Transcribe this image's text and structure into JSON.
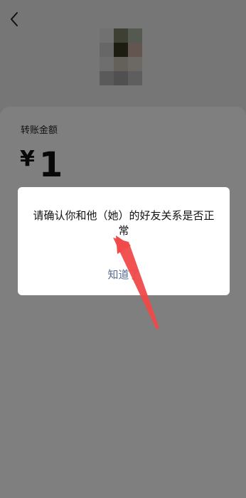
{
  "header": {
    "back_icon": "chevron-left-icon"
  },
  "transfer": {
    "label": "转账金额",
    "currency_symbol": "¥",
    "amount": "1"
  },
  "dialog": {
    "message": "请确认你和他（她）的好友关系是否正常",
    "button_label": "知道了"
  },
  "colors": {
    "dialog_button": "#576b95",
    "annotation_arrow": "#f04a4a",
    "overlay": "rgba(0,0,0,0.5)"
  }
}
